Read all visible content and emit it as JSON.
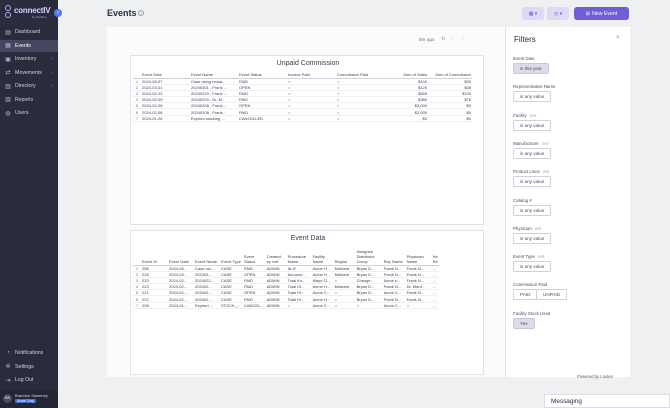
{
  "app": {
    "brand": "connectIV",
    "subtitle": "by Medline"
  },
  "nav": [
    {
      "label": "Dashboard",
      "icon": "dashboard-icon",
      "glyph": "▤"
    },
    {
      "label": "Events",
      "icon": "calendar-icon",
      "glyph": "▦",
      "active": true
    },
    {
      "label": "Inventory",
      "icon": "box-icon",
      "glyph": "▣",
      "chevron": true
    },
    {
      "label": "Movements",
      "icon": "arrows-icon",
      "glyph": "⇄",
      "chevron": true
    },
    {
      "label": "Directory",
      "icon": "book-icon",
      "glyph": "▥",
      "chevron": true
    },
    {
      "label": "Reports",
      "icon": "report-icon",
      "glyph": "▧"
    },
    {
      "label": "Users",
      "icon": "users-icon",
      "glyph": "◍"
    }
  ],
  "bottom_nav": [
    {
      "label": "Notifications",
      "icon": "bell-icon",
      "glyph": "◔"
    },
    {
      "label": "Settings",
      "icon": "gear-icon",
      "glyph": "✲"
    },
    {
      "label": "Log Out",
      "icon": "logout-icon",
      "glyph": "⇥"
    }
  ],
  "user": {
    "initials": "BS",
    "name": "Brandon Sweeney",
    "role": "Acme Corp"
  },
  "header": {
    "title": "Events",
    "new_event": "New Event"
  },
  "toolbar": {
    "refreshed": "5m ago"
  },
  "unpaid": {
    "title": "Unpaid Commission",
    "columns": [
      "",
      "Event Date",
      "Event Name",
      "Event Status",
      "Invoice Paid",
      "Commission Paid",
      "Sum of Sales",
      "Sum of Commission"
    ],
    "rows": [
      [
        "1",
        "2024-05-07",
        "Case using reusa...",
        "PAID",
        "○",
        "○",
        "$100",
        "$30"
      ],
      [
        "2",
        "2024-03-01",
        "20240301 - Frank ...",
        "OPEN",
        "○",
        "○",
        "$125",
        "$38"
      ],
      [
        "3",
        "2024-02-20",
        "20240220 - Frank ...",
        "PAID",
        "○",
        "○",
        "$650",
        "$130"
      ],
      [
        "4",
        "2024-02-09",
        "20240209 - Dr. M...",
        "PAID",
        "○",
        "○",
        "$380",
        "$76"
      ],
      [
        "5",
        "2024-02-08",
        "20240208 - Frank...",
        "OPEN",
        "○",
        "○",
        "$2,000",
        "$0"
      ],
      [
        "6",
        "2024-02-08",
        "20240208 - Frank...",
        "PAID",
        "○",
        "○",
        "$2,000",
        "$0"
      ],
      [
        "7",
        "2024-01-26",
        "Expired stocking ...",
        "CANCELLED",
        "○",
        "○",
        "$0",
        "$0"
      ]
    ]
  },
  "event_data": {
    "title": "Event Data",
    "columns": [
      "",
      "Event ID",
      "Event Date",
      "Event Name",
      "Event Type",
      "Event Status",
      "Created by role",
      "Procedure Name",
      "Facility Name",
      "Region",
      "Assigned Distributor Group",
      "Rep Name",
      "Physician Name",
      "He Re"
    ],
    "rows": [
      [
        "1",
        "258",
        "2024-05...",
        "Case usi...",
        "CASE",
        "PAID",
        "ADMIN",
        "ALIF",
        "Acme H...",
        "Midwest",
        "Bryan D...",
        "Frank N...",
        "Frank N...",
        "..."
      ],
      [
        "2",
        "228",
        "2024-03...",
        "202403...",
        "CASE",
        "OPEN",
        "ADMIN",
        "Acromio...",
        "Acme H...",
        "Midwest",
        "Bryan D...",
        "Frank N...",
        "Frank N...",
        "..."
      ],
      [
        "3",
        "233",
        "2024-02...",
        "2024022...",
        "CASE",
        "PAID",
        "ADMIN",
        "Total Kn...",
        "Mayo Cl...",
        "○",
        "Change...",
        "Acme s...",
        "Frank N...",
        "..."
      ],
      [
        "4",
        "223",
        "2024-02...",
        "202402...",
        "CASE",
        "PAID",
        "ADMIN",
        "Total Hi...",
        "Acme H...",
        "Midwest",
        "Bryan D...",
        "Frank N...",
        "Dr. Mant...",
        "..."
      ],
      [
        "5",
        "221",
        "2024-02...",
        "202402...",
        "CASE",
        "OPEN",
        "ADMIN",
        "Total Hi...",
        "Acme C...",
        "○",
        "Bryan D...",
        "Acme C...",
        "Frank N...",
        "..."
      ],
      [
        "6",
        "222",
        "2024-02...",
        "202402...",
        "CASE",
        "PAID",
        "ADMIN",
        "Total Hi...",
        "Acme H...",
        "○",
        "Bryan D...",
        "Frank N...",
        "Frank N...",
        "..."
      ],
      [
        "7",
        "208",
        "2024-01...",
        "Expired ...",
        "STOCK_...",
        "CANCEL...",
        "ADMIN",
        "○",
        "Acme C...",
        "○",
        "○",
        "Acme C...",
        "○",
        "..."
      ]
    ]
  },
  "filters": {
    "title": "Filters",
    "items": [
      {
        "label": "Event Date",
        "value": "is this year",
        "selected": true
      },
      {
        "label": "Representative Name",
        "value": "is any value"
      },
      {
        "label": "Facility",
        "link": "⊖⊖",
        "value": "is any value"
      },
      {
        "label": "Manufacturer",
        "link": "⊖⊖",
        "value": "is any value"
      },
      {
        "label": "Product Lines",
        "link": "⊖⊖",
        "value": "is any value"
      },
      {
        "label": "Catalog #",
        "value": "is any value"
      },
      {
        "label": "Physician",
        "link": "⊖⊖",
        "value": "is any value"
      },
      {
        "label": "Event Type",
        "link": "⊖⊖",
        "value": "is any value"
      }
    ],
    "commission": {
      "label": "Commission Paid",
      "opt1": "PAID",
      "opt2": "UNPAID"
    },
    "facility_stock": {
      "label": "Facility Stock Used",
      "value": "Yes"
    }
  },
  "footer": {
    "powered": "Powered by Looker",
    "messaging": "Messaging"
  }
}
